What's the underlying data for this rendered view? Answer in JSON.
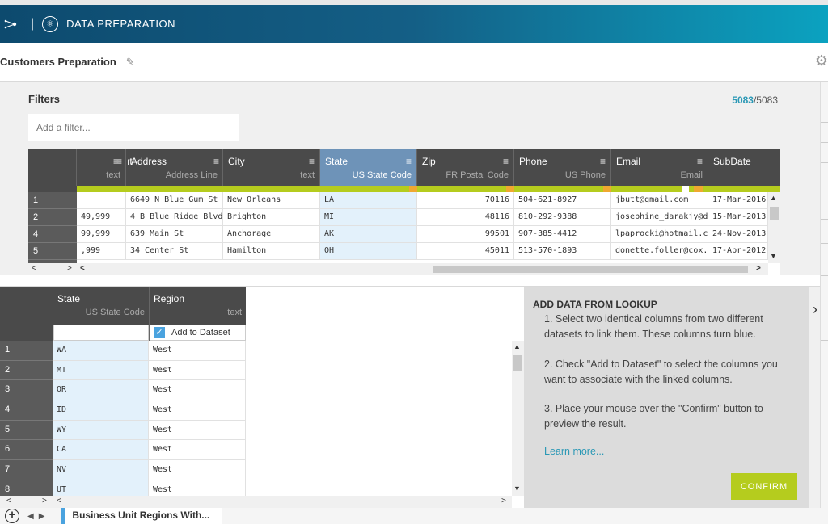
{
  "app": {
    "title": "DATA PREPARATION"
  },
  "preparation": {
    "name": "Customers Preparation"
  },
  "filters": {
    "label": "Filters",
    "placeholder": "Add a filter...",
    "count_filtered": "5083",
    "count_total": "/5083"
  },
  "main_grid": {
    "columns": [
      {
        "name": "ıt",
        "type": "text"
      },
      {
        "name": "Address",
        "type": "Address Line"
      },
      {
        "name": "City",
        "type": "text"
      },
      {
        "name": "State",
        "type": "US State Code"
      },
      {
        "name": "Zip",
        "type": "FR Postal Code"
      },
      {
        "name": "Phone",
        "type": "US Phone"
      },
      {
        "name": "Email",
        "type": "Email"
      },
      {
        "name": "SubDate",
        "type": ""
      }
    ],
    "row_numbers": [
      "1",
      "2",
      "4",
      "5"
    ],
    "rows": [
      [
        "",
        "6649 N Blue Gum St",
        "New Orleans",
        "LA",
        "70116",
        "504-621-8927",
        "jbutt@gmail.com",
        "17-Mar-2016"
      ],
      [
        "49,999",
        "4 B Blue Ridge Blvd",
        "Brighton",
        "MI",
        "48116",
        "810-292-9388",
        "josephine_darakjy@darakjy.org",
        "15-Mar-2013"
      ],
      [
        "99,999",
        "639 Main St",
        "Anchorage",
        "AK",
        "99501",
        "907-385-4412",
        "lpaprocki@hotmail.com",
        "24-Nov-2013"
      ],
      [
        ",999",
        "34 Center St",
        "Hamilton",
        "OH",
        "45011",
        "513-570-1893",
        "donette.foller@cox.net",
        "17-Apr-2012"
      ]
    ]
  },
  "lookup_grid": {
    "columns": [
      {
        "name": "State",
        "type": "US State Code"
      },
      {
        "name": "Region",
        "type": "text"
      }
    ],
    "add_to_dataset_label": "Add to Dataset",
    "row_numbers": [
      "1",
      "2",
      "3",
      "4",
      "5",
      "6",
      "7",
      "8"
    ],
    "rows": [
      [
        "WA",
        "West"
      ],
      [
        "MT",
        "West"
      ],
      [
        "OR",
        "West"
      ],
      [
        "ID",
        "West"
      ],
      [
        "WY",
        "West"
      ],
      [
        "CA",
        "West"
      ],
      [
        "NV",
        "West"
      ],
      [
        "UT",
        "West"
      ]
    ]
  },
  "lookup_panel": {
    "title": "ADD DATA FROM LOOKUP",
    "step1": "1. Select two identical columns from two different datasets to link them. These columns turn blue.",
    "step2": "2. Check \"Add to Dataset\" to select the columns you want to associate with the linked columns.",
    "step3": "3. Place your mouse over the \"Confirm\" button to preview the result.",
    "learn_more": "Learn more...",
    "confirm_label": "CONFIRM"
  },
  "bottom_bar": {
    "lookup_tab": "Business Unit Regions With..."
  },
  "colors": {
    "accent": "#2a98b5",
    "selected_column": "#6e93b8",
    "quality_valid": "#b5cc1e",
    "confirm": "#b5cc1e",
    "selected_cell": "#e3f1fb"
  }
}
